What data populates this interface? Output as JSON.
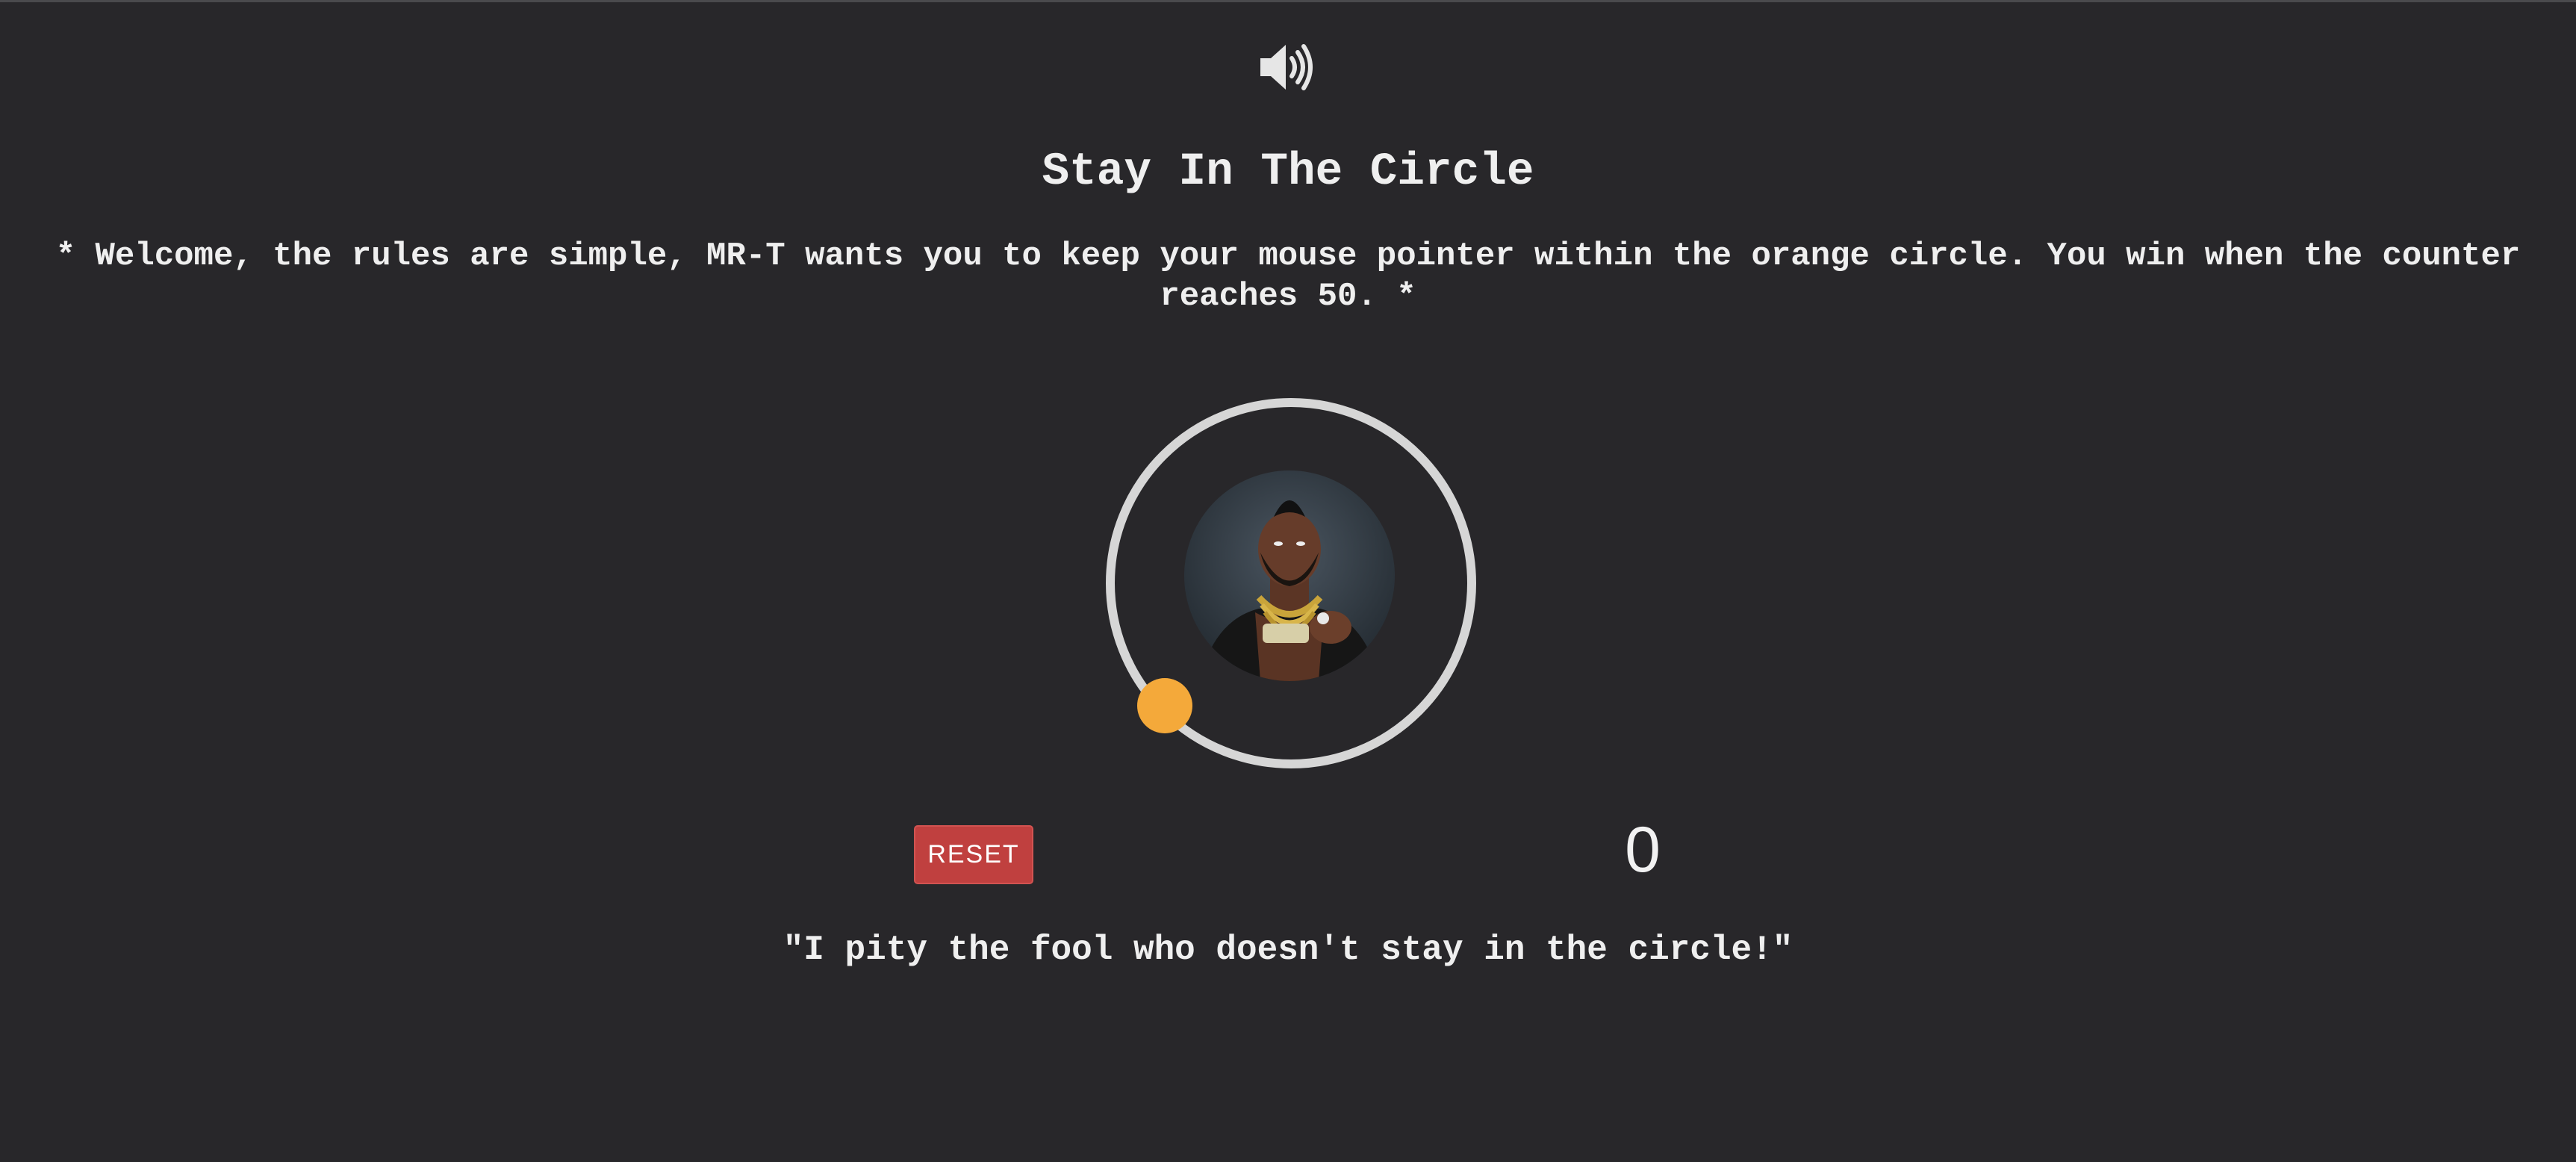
{
  "header": {
    "sound_icon": "speaker-volume-icon"
  },
  "game": {
    "title": "Stay In The Circle",
    "rules": "* Welcome, the rules are simple, MR-T wants you to keep your mouse pointer within the orange circle. You win when the counter reaches 50. *",
    "counter": "0",
    "win_target": 50,
    "reset_label": "RESET",
    "quote": "\"I pity the fool who doesn't stay in the circle!\""
  },
  "colors": {
    "background": "#28272a",
    "text": "#efefef",
    "ring": "#d6d6d6",
    "target": "#f4a93a",
    "reset_button": "#c0403f"
  }
}
